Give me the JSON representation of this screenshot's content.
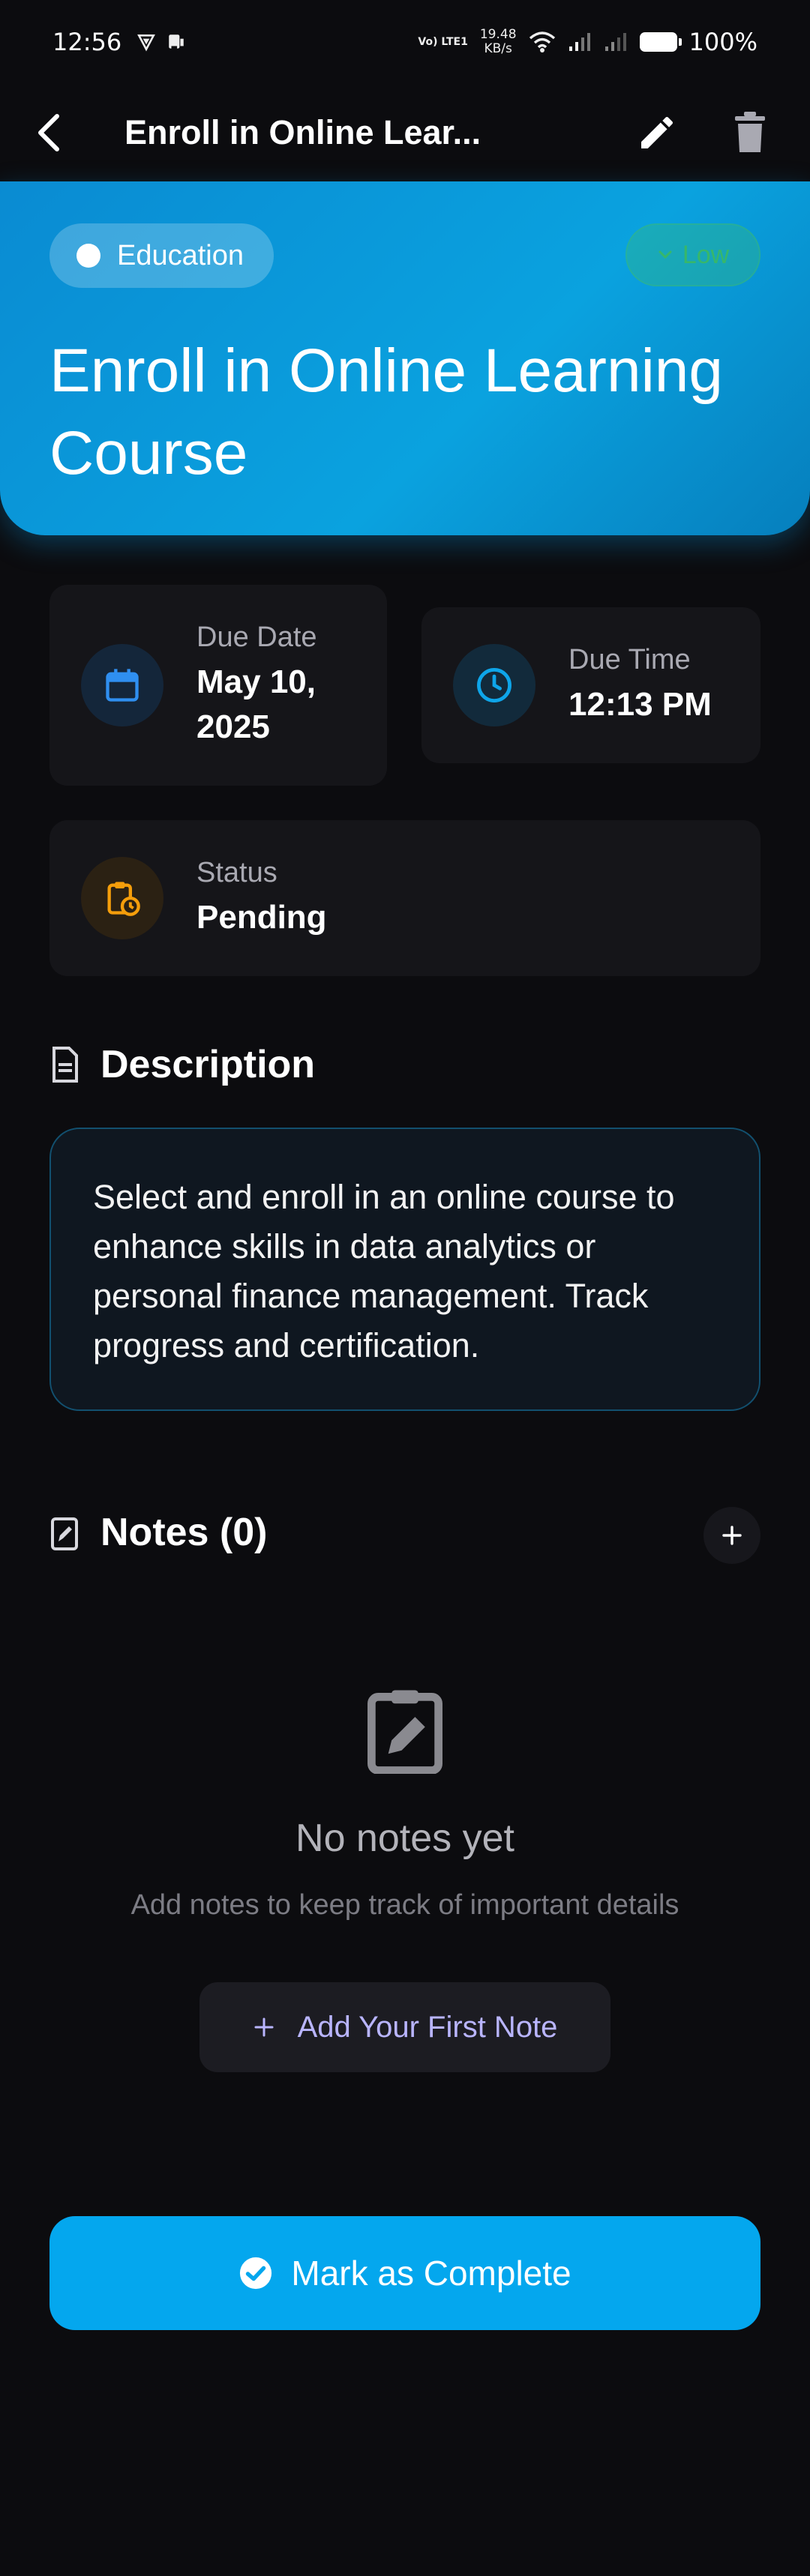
{
  "status_bar": {
    "time": "12:56",
    "volte": "Vo) LTE1",
    "net_speed_value": "19.48",
    "net_speed_unit": "KB/s",
    "battery": "100%"
  },
  "app_bar": {
    "title": "Enroll in Online Lear...",
    "back_icon": "back-arrow-icon",
    "edit_icon": "pencil-icon",
    "delete_icon": "trash-icon"
  },
  "header": {
    "category": "Education",
    "priority": "Low",
    "title_line1": "Enroll in Online Learning",
    "title_line2": "Course",
    "colors": {
      "gradient_start": "#0a8bd2",
      "gradient_end": "#067fbd",
      "priority": "#37b76a"
    }
  },
  "details": {
    "due_date_label": "Due Date",
    "due_date_line1": "May 10,",
    "due_date_line2": "2025",
    "due_time_label": "Due Time",
    "due_time_value": "12:13 PM",
    "status_label": "Status",
    "status_value": "Pending"
  },
  "description": {
    "heading": "Description",
    "text": "Select and enroll in an online course to enhance skills in data analytics or personal finance management. Track progress and certification."
  },
  "notes": {
    "heading": "Notes (0)",
    "empty_title": "No notes yet",
    "empty_subtitle": "Add notes to keep track of important details",
    "add_first_label": "Add Your First Note"
  },
  "actions": {
    "complete_label": "Mark as Complete",
    "complete_color": "#04a7ee"
  }
}
